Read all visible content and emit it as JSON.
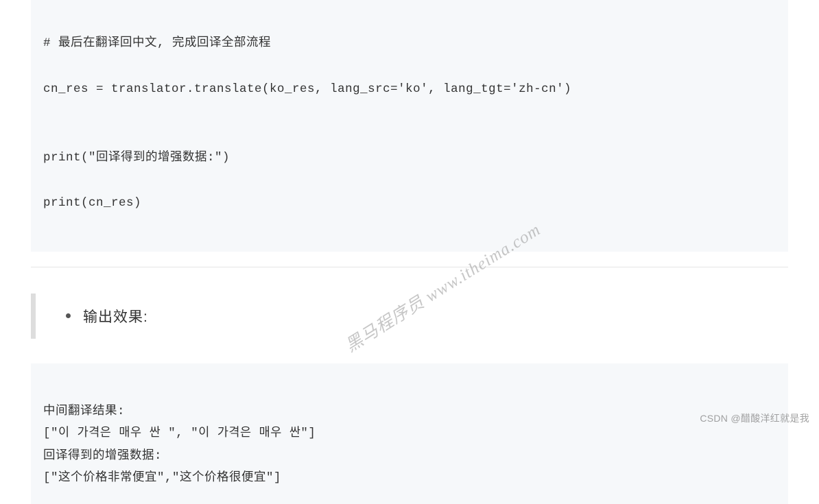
{
  "code": {
    "line1": "# 最后在翻译回中文, 完成回译全部流程",
    "line2": "cn_res = translator.translate(ko_res, lang_src='ko', lang_tgt='zh-cn')",
    "line3": "",
    "line4": "print(\"回译得到的增强数据:\")",
    "line5": "print(cn_res)"
  },
  "section": {
    "bullet_label": "输出效果:"
  },
  "output": {
    "line1": "中间翻译结果:",
    "line2": "[\"이 가격은 매우 싼 \", \"이 가격은 매우 싼\"]",
    "line3": "回译得到的增强数据:",
    "line4": "[\"这个价格非常便宜\",\"这个价格很便宜\"]"
  },
  "watermark_text": "黑马程序员 www.itheima.com",
  "attribution_text": "CSDN @醋酸洋红就是我"
}
